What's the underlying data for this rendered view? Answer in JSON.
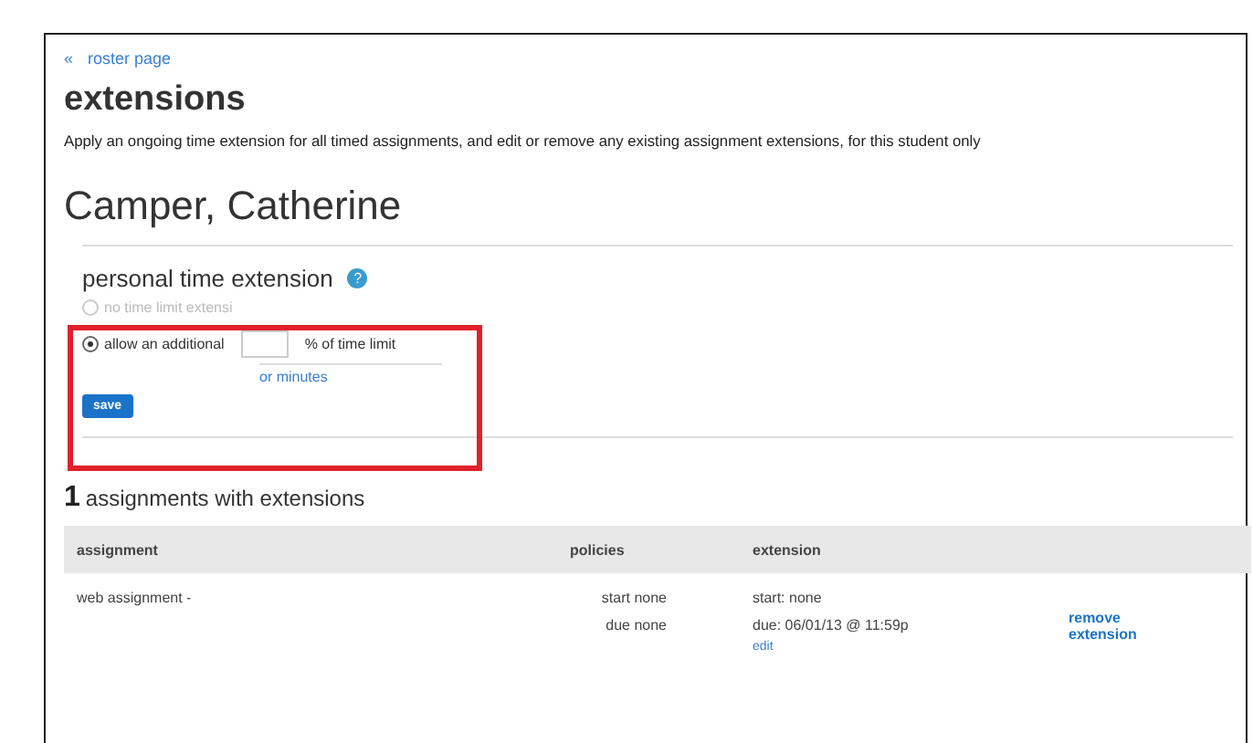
{
  "breadcrumb": {
    "arrow": "«",
    "label": "roster page"
  },
  "title": "extensions",
  "description": "Apply an ongoing time extension for all timed assignments, and edit or remove any existing assignment extensions, for this student only",
  "student": "Camper, Catherine",
  "time_extension": {
    "heading": "personal time extension",
    "options": [
      {
        "label": "no time limit extensi",
        "selected": false,
        "disabled": true
      },
      {
        "label": "allow an additional",
        "selected": true,
        "disabled": false
      }
    ],
    "help": "?",
    "unit": "% of time limit",
    "minutes_link": "or minutes",
    "save": "save"
  },
  "assignments": {
    "count": "1",
    "heading": "assignments with extensions",
    "columns": [
      "assignment",
      "policies",
      "extension"
    ],
    "rows": [
      {
        "assignment": "web assignment -",
        "policies": [
          "start none",
          "due none"
        ],
        "extension": [
          "start: none",
          "due: 06/01/13 @ 11:59p"
        ],
        "edit": "edit",
        "remove": "remove extension"
      }
    ]
  }
}
